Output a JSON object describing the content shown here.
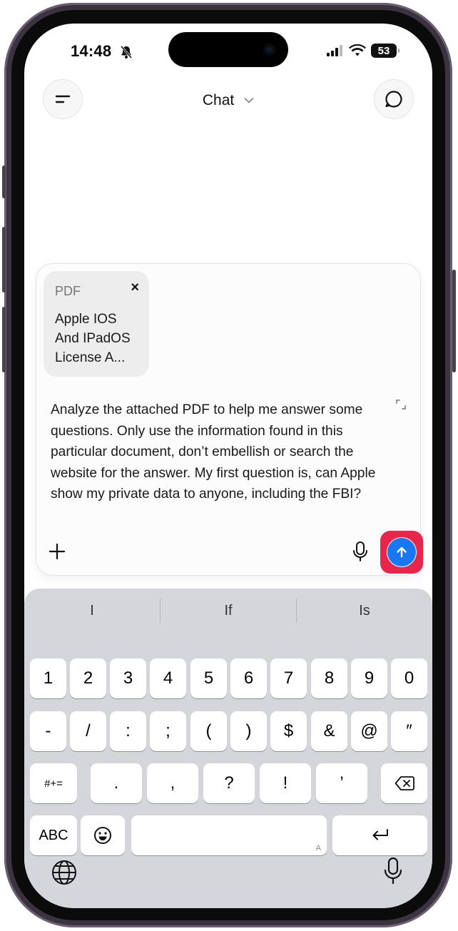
{
  "status_bar": {
    "time": "14:48",
    "battery": "53",
    "icons": [
      "bell-slash-icon",
      "signal-icon",
      "wifi-icon",
      "battery-icon"
    ]
  },
  "header": {
    "title": "Chat",
    "menu_icon": "menu-icon",
    "new_chat_icon": "new-chat-icon"
  },
  "attachment": {
    "type": "PDF",
    "name": "Apple IOS And IPadOS License A...",
    "close": "×"
  },
  "composer": {
    "text": "Analyze the attached PDF to help me answer some questions. Only use the information found in this particular document, don’t embellish or search the website for the answer. My first question is, can Apple show my private data to anyone, including the FBI?"
  },
  "keyboard": {
    "suggestions": [
      "I",
      "If",
      "Is"
    ],
    "row1": [
      "1",
      "2",
      "3",
      "4",
      "5",
      "6",
      "7",
      "8",
      "9",
      "0"
    ],
    "row2": [
      "-",
      "/",
      ":",
      ";",
      "(",
      ")",
      "$",
      "&",
      "@",
      "″"
    ],
    "row3_left": "#+=",
    "row3": [
      ".",
      ",",
      "?",
      "!",
      "’"
    ],
    "abc": "ABC",
    "space_hint": "A",
    "colors": {
      "send": "#1877f2",
      "highlight": "#e8254a"
    }
  }
}
